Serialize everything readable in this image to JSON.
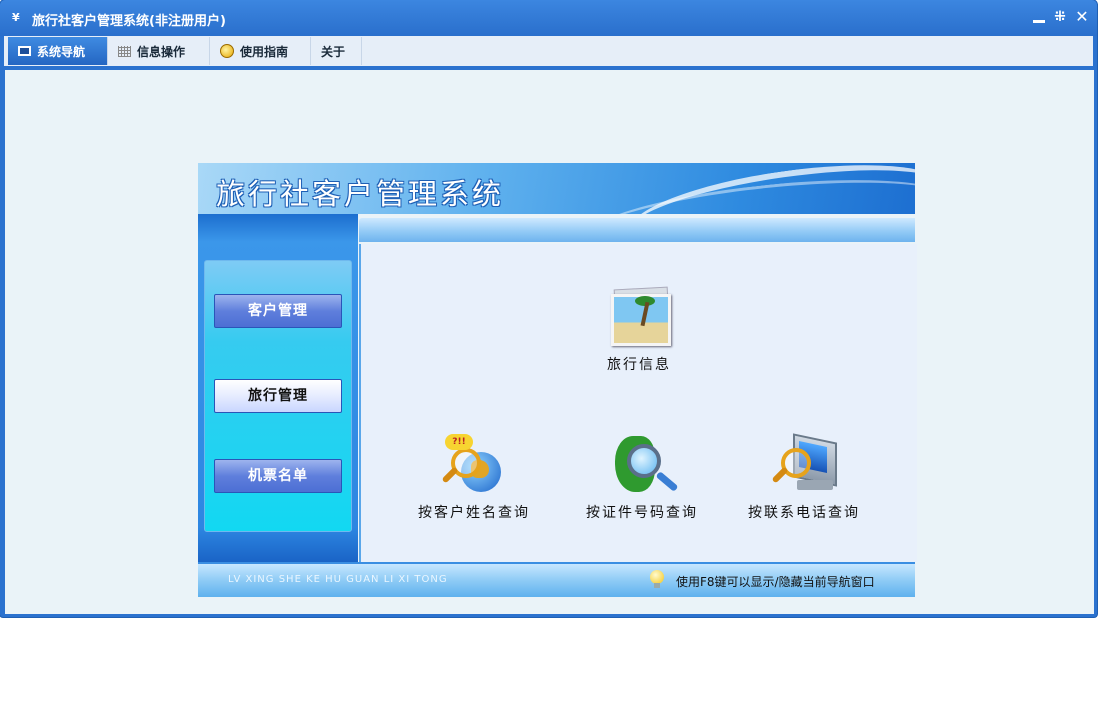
{
  "window": {
    "title": "旅行社客户管理系统(非注册用户)",
    "icon": "app-logo-icon",
    "controls": [
      "minimize-icon",
      "restore-icon",
      "close-icon"
    ]
  },
  "tabs": [
    {
      "label": "系统导航",
      "icon": "monitor-icon",
      "active": true
    },
    {
      "label": "信息操作",
      "icon": "grid-icon",
      "active": false
    },
    {
      "label": "使用指南",
      "icon": "coin-icon",
      "active": false
    },
    {
      "label": "关于",
      "active": false
    }
  ],
  "panel": {
    "banner_title": "旅行社客户管理系统",
    "nav_buttons": [
      {
        "label": "客户管理",
        "selected": false
      },
      {
        "label": "旅行管理",
        "selected": true
      },
      {
        "label": "机票名单",
        "selected": false
      }
    ],
    "functions": {
      "travel_info": {
        "label": "旅行信息",
        "icon": "photo-icon"
      },
      "by_name": {
        "label": "按客户姓名查询",
        "icon": "globe-search-icon"
      },
      "by_id": {
        "label": "按证件号码查询",
        "icon": "map-search-icon"
      },
      "by_phone": {
        "label": "按联系电话查询",
        "icon": "monitor-search-icon"
      }
    },
    "footer": {
      "pinyin": "LV XING SHE KE HU GUAN LI XI TONG",
      "hint": "使用F8键可以显示/隐藏当前导航窗口",
      "hint_icon": "lightbulb-icon"
    }
  },
  "colors": {
    "window_blue": "#2b72cf",
    "content_bg": "#eaf3f8",
    "nav_button": "#5f7fdc",
    "nav_panel_cyan": "#12d8f2"
  }
}
